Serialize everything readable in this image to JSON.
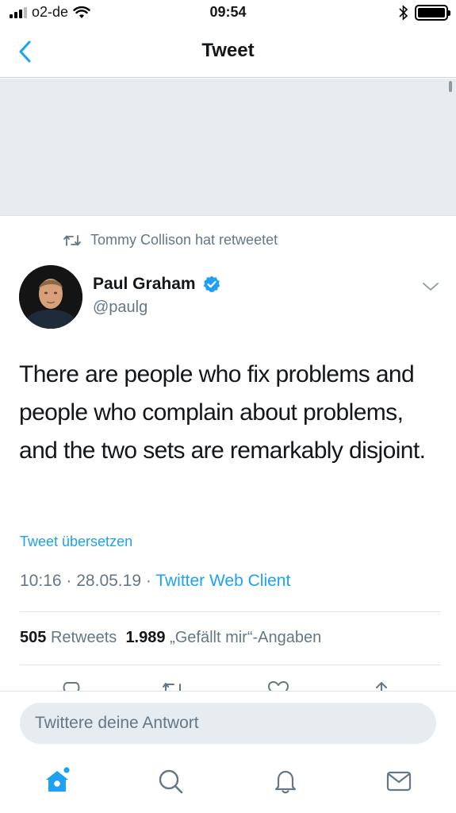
{
  "status_bar": {
    "carrier": "o2-de",
    "time": "09:54",
    "battery_level": 1.0
  },
  "nav": {
    "title": "Tweet",
    "back_icon": "chevron-left-icon"
  },
  "tweet": {
    "retweet_context": "Tommy Collison hat retweetet",
    "author_name": "Paul Graham",
    "author_handle": "@paulg",
    "verified": true,
    "text": "There are people who fix problems and people who complain about problems, and the two sets are remarkably disjoint.",
    "translate_label": "Tweet übersetzen",
    "time": "10:16",
    "date": "28.05.19",
    "separator": "·",
    "client": "Twitter Web Client",
    "retweet_count": "505",
    "retweet_label": "Retweets",
    "like_count": "1.989",
    "like_label": "„Gefällt mir“-Angaben"
  },
  "reply": {
    "placeholder": "Twittere deine Antwort"
  },
  "tab_bar": {
    "items": [
      "home-icon",
      "search-icon",
      "notifications-icon",
      "messages-icon"
    ],
    "active": "home-icon",
    "home_has_badge": true
  },
  "colors": {
    "accent": "#1da1f2",
    "secondary_text": "#657786",
    "media_placeholder": "#e6ecf0"
  }
}
